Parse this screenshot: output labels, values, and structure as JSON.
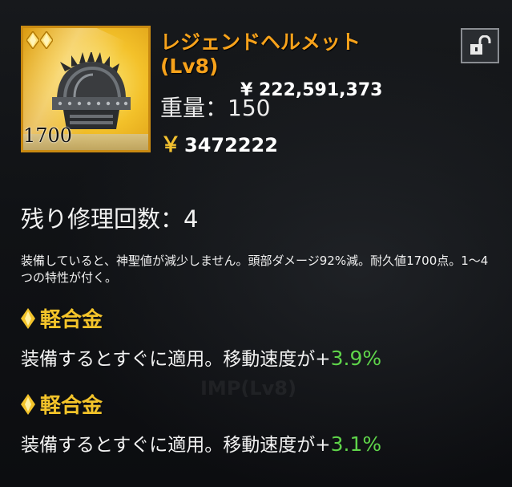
{
  "item": {
    "name": "レジェンドヘルメット",
    "level": "(Lv8)",
    "weight_label": "重量：",
    "weight_value": "150",
    "currency_symbol": "￥",
    "price": "3472222",
    "durability": "1700",
    "rarity_gems": 2,
    "icon": "spiked-helmet-icon"
  },
  "lock": {
    "icon": "unlock-icon"
  },
  "repairs": {
    "label": "残り修理回数：",
    "value": "4"
  },
  "description": "装備していると、神聖値が減少しません。頭部ダメージ92%減。耐久値1700点。1〜4つの特性が付く。",
  "traits": [
    {
      "title": "軽合金",
      "effect_text": "装備するとすぐに適用。移動速度が+",
      "effect_value": "3.9%"
    },
    {
      "title": "軽合金",
      "effect_text": "装備するとすぐに適用。移動速度が+",
      "effect_value": "3.1%"
    }
  ],
  "colors": {
    "name": "#f7a21b",
    "trait_title": "#f4c42a",
    "bonus_value": "#5fd44a",
    "icon_frame": "#c98a12"
  }
}
